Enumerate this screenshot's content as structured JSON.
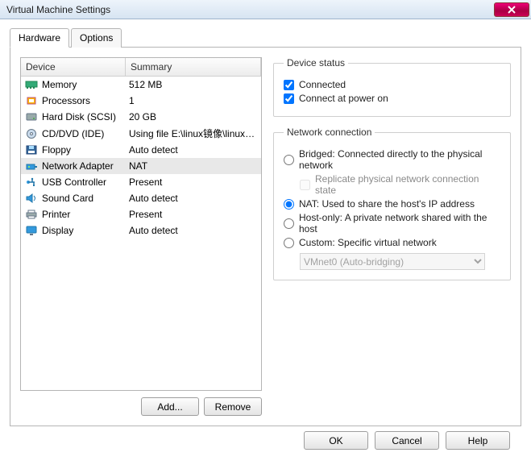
{
  "window": {
    "title": "Virtual Machine Settings"
  },
  "tabs": {
    "hardware": "Hardware",
    "options": "Options"
  },
  "devlist": {
    "header_device": "Device",
    "header_summary": "Summary",
    "items": [
      {
        "name": "Memory",
        "summary": "512 MB",
        "icon": "memory"
      },
      {
        "name": "Processors",
        "summary": "1",
        "icon": "cpu"
      },
      {
        "name": "Hard Disk (SCSI)",
        "summary": "20 GB",
        "icon": "hdd"
      },
      {
        "name": "CD/DVD (IDE)",
        "summary": "Using file E:\\linux镜像\\linuxS...",
        "icon": "cd"
      },
      {
        "name": "Floppy",
        "summary": "Auto detect",
        "icon": "floppy"
      },
      {
        "name": "Network Adapter",
        "summary": "NAT",
        "icon": "net",
        "selected": true
      },
      {
        "name": "USB Controller",
        "summary": "Present",
        "icon": "usb"
      },
      {
        "name": "Sound Card",
        "summary": "Auto detect",
        "icon": "sound"
      },
      {
        "name": "Printer",
        "summary": "Present",
        "icon": "printer"
      },
      {
        "name": "Display",
        "summary": "Auto detect",
        "icon": "display"
      }
    ]
  },
  "buttons": {
    "add": "Add...",
    "remove": "Remove",
    "ok": "OK",
    "cancel": "Cancel",
    "help": "Help"
  },
  "panel": {
    "status_legend": "Device status",
    "connected": "Connected",
    "connect_power": "Connect at power on",
    "net_legend": "Network connection",
    "bridged": "Bridged: Connected directly to the physical network",
    "replicate": "Replicate physical network connection state",
    "nat": "NAT: Used to share the host's IP address",
    "hostonly": "Host-only: A private network shared with the host",
    "custom": "Custom: Specific virtual network",
    "vnet": "VMnet0 (Auto-bridging)"
  }
}
